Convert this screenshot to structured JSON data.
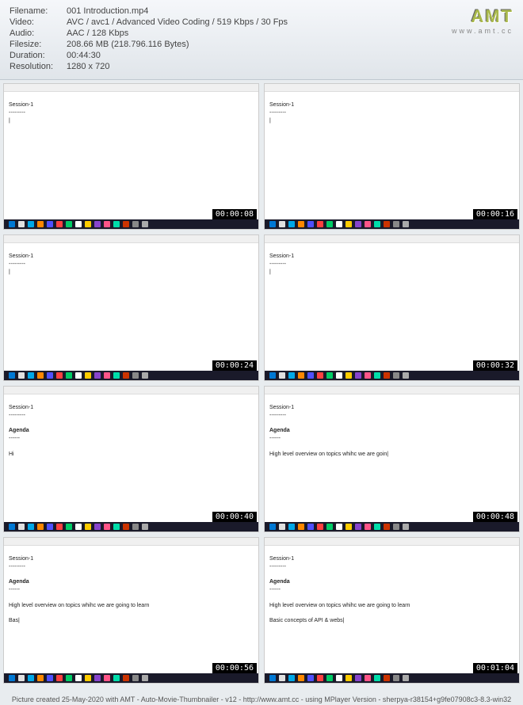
{
  "header": {
    "filename_label": "Filename:",
    "filename_value": "001 Introduction.mp4",
    "video_label": "Video:",
    "video_value": "AVC / avc1 / Advanced Video Coding / 519 Kbps / 30 Fps",
    "audio_label": "Audio:",
    "audio_value": "AAC / 128 Kbps",
    "filesize_label": "Filesize:",
    "filesize_value": "208.66 MB (218.796.116 Bytes)",
    "duration_label": "Duration:",
    "duration_value": "00:44:30",
    "resolution_label": "Resolution:",
    "resolution_value": "1280 x 720"
  },
  "logo": {
    "text": "AMT",
    "url": "www.amt.cc"
  },
  "thumbs": [
    {
      "timestamp": "00:00:08",
      "session": "Session-1",
      "dashes": "---------",
      "lines": [
        "|"
      ]
    },
    {
      "timestamp": "00:00:16",
      "session": "Session-1",
      "dashes": "---------",
      "lines": [
        "|"
      ]
    },
    {
      "timestamp": "00:00:24",
      "session": "Session-1",
      "dashes": "---------",
      "lines": [
        "|"
      ]
    },
    {
      "timestamp": "00:00:32",
      "session": "Session-1",
      "dashes": "---------",
      "lines": [
        "|"
      ]
    },
    {
      "timestamp": "00:00:40",
      "session": "Session-1",
      "dashes": "---------",
      "lines": [
        "",
        "Agenda",
        "------",
        "",
        "Hi"
      ]
    },
    {
      "timestamp": "00:00:48",
      "session": "Session-1",
      "dashes": "---------",
      "lines": [
        "",
        "Agenda",
        "------",
        "",
        "High level overview on topics whihc we are goin|"
      ]
    },
    {
      "timestamp": "00:00:56",
      "session": "Session-1",
      "dashes": "---------",
      "lines": [
        "",
        "Agenda",
        "------",
        "",
        "High level overview on topics whihc we are going to learn",
        "",
        "Bas|"
      ]
    },
    {
      "timestamp": "00:01:04",
      "session": "Session-1",
      "dashes": "---------",
      "lines": [
        "",
        "Agenda",
        "------",
        "",
        "High level overview on topics whihc we are going to learn",
        "",
        "Basic concepts of API & webs|"
      ]
    }
  ],
  "taskbar_colors": [
    "#0078d4",
    "#e0e0e0",
    "#00a8e8",
    "#ff8800",
    "#5050ff",
    "#ff4040",
    "#00cc66",
    "#fff",
    "#ffcc00",
    "#8844cc",
    "#ff5588",
    "#00ddaa",
    "#cc3300",
    "#888",
    "#aaa"
  ],
  "footer": "Picture created 25-May-2020 with AMT - Auto-Movie-Thumbnailer - v12 - http://www.amt.cc - using MPlayer Version - sherpya-r38154+g9fe07908c3-8.3-win32"
}
